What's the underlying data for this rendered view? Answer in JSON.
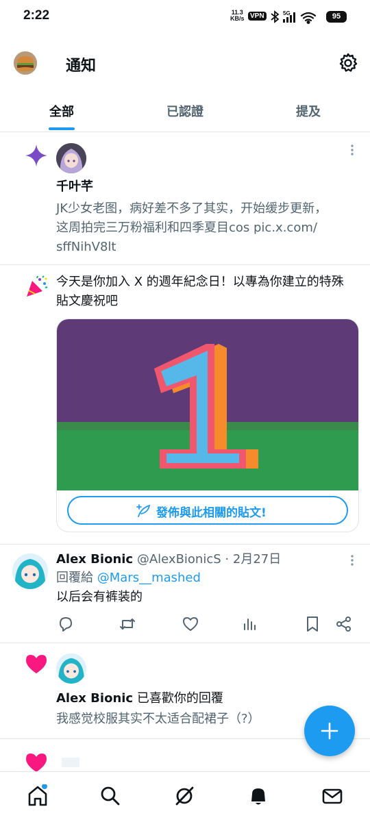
{
  "status_bar": {
    "time": "2:22",
    "net_speed_value": "11.3",
    "net_speed_unit": "KB/s",
    "vpn": "VPN",
    "signal_type": "5G",
    "battery": "95"
  },
  "header": {
    "title": "通知"
  },
  "tabs": [
    {
      "label": "全部"
    },
    {
      "label": "已認證"
    },
    {
      "label": "提及"
    }
  ],
  "notifications": {
    "n1": {
      "icon": "sparkle-icon",
      "name": "千叶芊",
      "text_line1": "JK少女老图，病好差不多了其实，开始缓步更新，",
      "text_line2": "这周拍完三万粉福利和四季夏目cos pic.x.com/",
      "text_line3": "sffNihV8lt"
    },
    "n2": {
      "icon": "party-popper-icon",
      "text_line1": "今天是你加入 X 的週年紀念日！以專為你建立的特殊",
      "text_line2": "貼文慶祝吧",
      "image_caption": "1",
      "button_label": "發佈與此相關的貼文!"
    },
    "tweet": {
      "name": "Alex Bionic",
      "handle": "@AlexBionicS",
      "separator": "·",
      "date": "2月27日",
      "reply_prefix": "回覆給",
      "reply_to": "@Mars__mashed",
      "text": "以后会有裤装的"
    },
    "n4": {
      "icon": "heart-icon",
      "name": "Alex Bionic",
      "action": "已喜歡你的回覆",
      "text": "我感觉校服其实不太适合配裙子（?）"
    },
    "n5": {
      "icon": "heart-icon"
    }
  },
  "colors": {
    "accent": "#1d9bf0",
    "sparkle": "#794bc4",
    "like": "#f91880",
    "gray_text": "#536471"
  }
}
